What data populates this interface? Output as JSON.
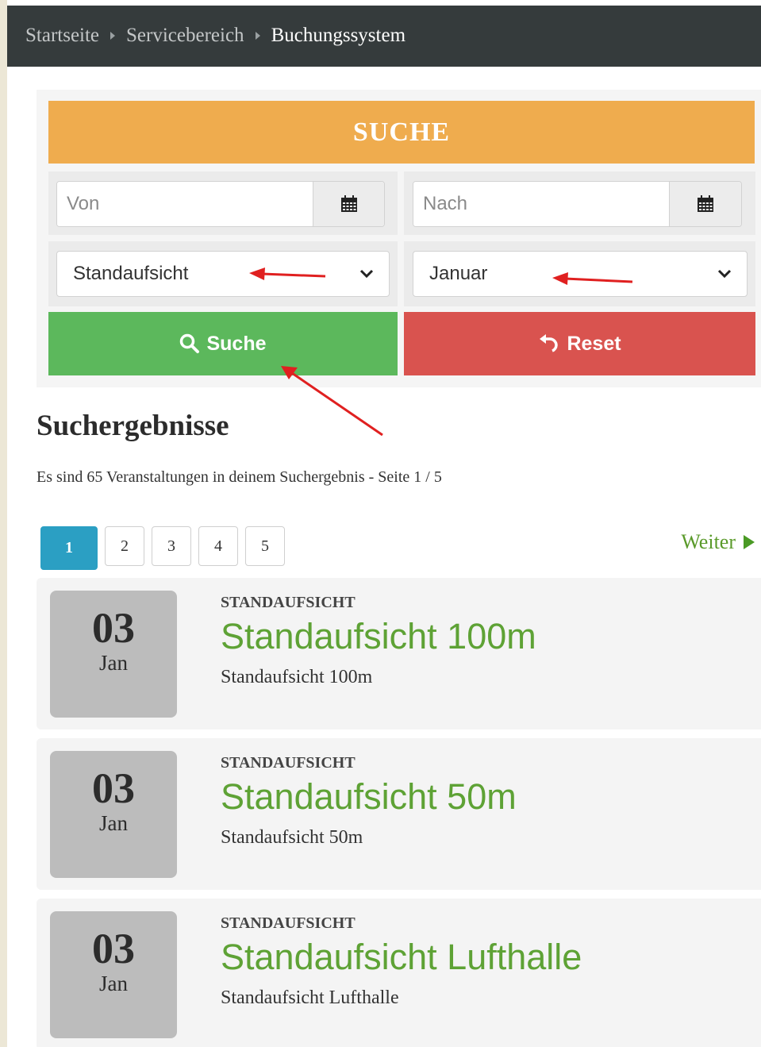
{
  "breadcrumb": {
    "home": "Startseite",
    "service": "Servicebereich",
    "current": "Buchungssystem"
  },
  "search": {
    "header": "SUCHE",
    "from_placeholder": "Von",
    "to_placeholder": "Nach",
    "category_selected": "Standaufsicht",
    "month_selected": "Januar",
    "search_label": "Suche",
    "reset_label": "Reset",
    "calendar_icon": "calendar-icon",
    "search_icon": "magnifier-icon",
    "reset_icon": "undo-icon"
  },
  "results": {
    "title": "Suchergebnisse",
    "summary": "Es sind 65 Veranstaltungen in deinem Suchergebnis - Seite 1 / 5",
    "pages": [
      "1",
      "2",
      "3",
      "4",
      "5"
    ],
    "current_page": "1",
    "next_label": "Weiter"
  },
  "events": [
    {
      "day": "03",
      "month": "Jan",
      "category": "STANDAUFSICHT",
      "title": "Standaufsicht 100m",
      "subtitle": "Standaufsicht 100m"
    },
    {
      "day": "03",
      "month": "Jan",
      "category": "STANDAUFSICHT",
      "title": "Standaufsicht 50m",
      "subtitle": "Standaufsicht 50m"
    },
    {
      "day": "03",
      "month": "Jan",
      "category": "STANDAUFSICHT",
      "title": "Standaufsicht Lufthalle",
      "subtitle": "Standaufsicht Lufthalle"
    }
  ],
  "colors": {
    "header_orange": "#efac4e",
    "search_green": "#5cb85c",
    "reset_red": "#d9534f",
    "pager_active": "#2b9fc3",
    "title_green": "#5ea235",
    "annotation_arrow": "#e02020"
  }
}
